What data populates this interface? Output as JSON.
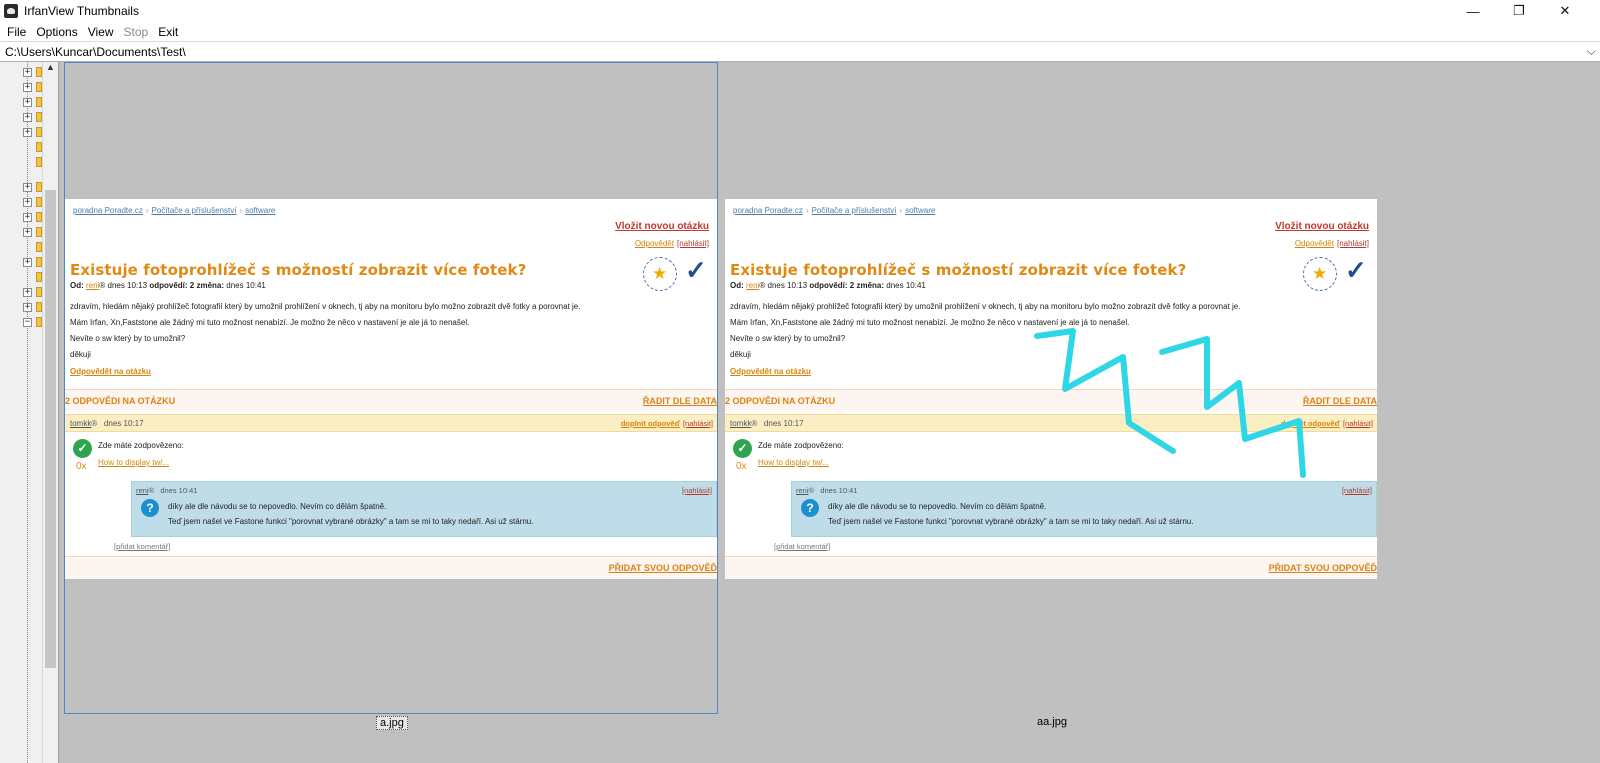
{
  "window": {
    "title": "IrfanView Thumbnails",
    "controls": {
      "minimize": "—",
      "maximize": "❐",
      "close": "✕"
    }
  },
  "menu": [
    "File",
    "Options",
    "View",
    "Stop",
    "Exit"
  ],
  "menu_disabled": [
    "Stop"
  ],
  "path": "C:\\Users\\Kuncar\\Documents\\Test\\",
  "thumbnails": [
    {
      "caption": "a.jpg",
      "selected": true
    },
    {
      "caption": "aa.jpg",
      "selected": false
    }
  ],
  "webpage": {
    "breadcrumb": [
      "poradna Poradte.cz",
      "Počítače a příslušenství",
      "software"
    ],
    "new_question": "Vložit novou otázku",
    "reply_top": "Odpovědět",
    "report_top": "[nahlásit]",
    "question_title": "Existuje fotoprohlížeč s možností zobrazit více fotek?",
    "meta": {
      "from_label": "Od:",
      "author": "reni",
      "author_mark": "®",
      "time": "dnes 10:13",
      "answers_label": "odpovědí:",
      "answers_count": "2",
      "change_label": "změna:",
      "change_time": "dnes 10:41"
    },
    "body_lines": [
      "zdravím, hledám nějaký prohlížeč fotografií který by umožnil prohlížení v oknech, tj aby na monitoru bylo možno zobrazit dvě fotky a porovnat je.",
      "Mám Irfan, Xn,Faststone ale žádný mi tuto možnost nenabízí. Je možno že něco v nastavení je ale já to nenašel.",
      "Nevíte o sw který by to umožnil?",
      "děkuji"
    ],
    "answer_link": "Odpovědět na otázku",
    "answers_heading": "2 ODPOVĚDI NA OTÁZKU",
    "sort_label": "ŘADIT DLE DATA",
    "answer": {
      "user": "tomkk",
      "user_mark": "®",
      "time": "dnes 10:17",
      "add_answer": "doplnit odpověď",
      "report": "[nahlásit]",
      "text": "Zde máte zodpovězeno:",
      "link": "How to display tw/...",
      "score": "0x"
    },
    "comment": {
      "user": "reni",
      "user_mark": "®",
      "time": "dnes 10:41",
      "report": "[nahlásit]",
      "line1": "díky ale dle návodu se to nepovedlo. Nevím co dělám špatně.",
      "line2": "Teď jsem našel ve Fastone funkci \"porovnat vybrané obrázky\" a tam se mi to taky nedaří. Asi už stárnu."
    },
    "add_comment": "[přidat komentář]",
    "add_answer": "PŘIDAT SVOU ODPOVĚĎ"
  },
  "colors": {
    "accent_orange": "#e08a16",
    "report_red": "#b03a2e",
    "comment_blue": "#bfdde8",
    "scribble": "#2fd6e6",
    "selection": "#4f86c6"
  }
}
